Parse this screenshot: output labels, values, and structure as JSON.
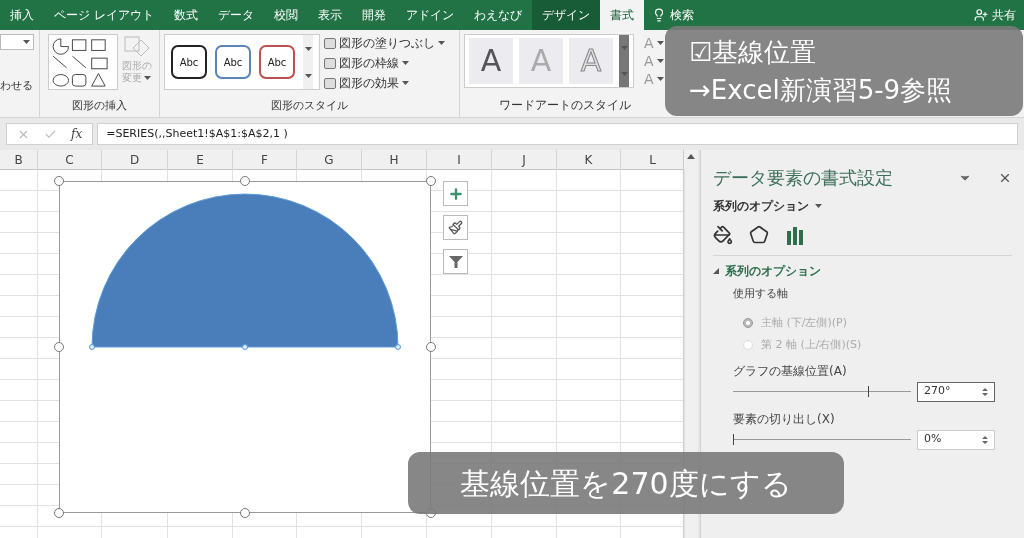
{
  "ribbon_tabs": [
    {
      "label": "挿入",
      "selected": false,
      "contextual": false
    },
    {
      "label": "ページ レイアウト",
      "selected": false,
      "contextual": false
    },
    {
      "label": "数式",
      "selected": false,
      "contextual": false
    },
    {
      "label": "データ",
      "selected": false,
      "contextual": false
    },
    {
      "label": "校閲",
      "selected": false,
      "contextual": false
    },
    {
      "label": "表示",
      "selected": false,
      "contextual": false
    },
    {
      "label": "開発",
      "selected": false,
      "contextual": false
    },
    {
      "label": "アドイン",
      "selected": false,
      "contextual": false
    },
    {
      "label": "わえなび",
      "selected": false,
      "contextual": false
    },
    {
      "label": "デザイン",
      "selected": false,
      "contextual": true
    },
    {
      "label": "書式",
      "selected": true,
      "contextual": true
    }
  ],
  "tell_me": "検索",
  "share": "共有",
  "ribbon": {
    "partial_label": "わせる",
    "insert_shapes": {
      "title": "図形の挿入",
      "change_shape": {
        "line1": "図形の",
        "line2": "変更",
        "disabled": true
      }
    },
    "shape_styles": {
      "title": "図形のスタイル",
      "presets": [
        {
          "label": "Abc",
          "color": "#222222"
        },
        {
          "label": "Abc",
          "color": "#5b84b8"
        },
        {
          "label": "Abc",
          "color": "#c0504d"
        }
      ],
      "commands": [
        "図形の塗りつぶし",
        "図形の枠線",
        "図形の効果"
      ]
    },
    "wordart_styles": {
      "title": "ワードアートのスタイル",
      "presets": [
        "A",
        "A",
        "A"
      ],
      "commands": [
        "A",
        "A",
        "A"
      ]
    }
  },
  "formula_bar": {
    "function_label": "fx",
    "formula": "=SERIES(,,Sheet1!$A$1:$A$2,1 )"
  },
  "columns": [
    "B",
    "C",
    "D",
    "E",
    "F",
    "G",
    "H",
    "I",
    "J",
    "K",
    "L"
  ],
  "format_pane": {
    "title": "データ要素の書式設定",
    "options_menu": "系列のオプション",
    "section": {
      "title": "系列のオプション",
      "expanded": true
    },
    "axis_label": "使用する軸",
    "axes": [
      {
        "label": "主軸 (下/左側)(P)",
        "selected": true,
        "disabled": true
      },
      {
        "label": "第 2 軸 (上/右側)(S)",
        "selected": false,
        "disabled": true
      }
    ],
    "settings": [
      {
        "label": "グラフの基線位置(A)",
        "level": 0.76,
        "value": "270°",
        "focused": true
      },
      {
        "label": "要素の切り出し(X)",
        "level": 0,
        "value": "0%",
        "focused": false
      }
    ]
  },
  "captions": {
    "note": [
      "☑基線位置",
      "→Excel新演習5-9参照"
    ],
    "subtitle": "基線位置を270度にする"
  }
}
